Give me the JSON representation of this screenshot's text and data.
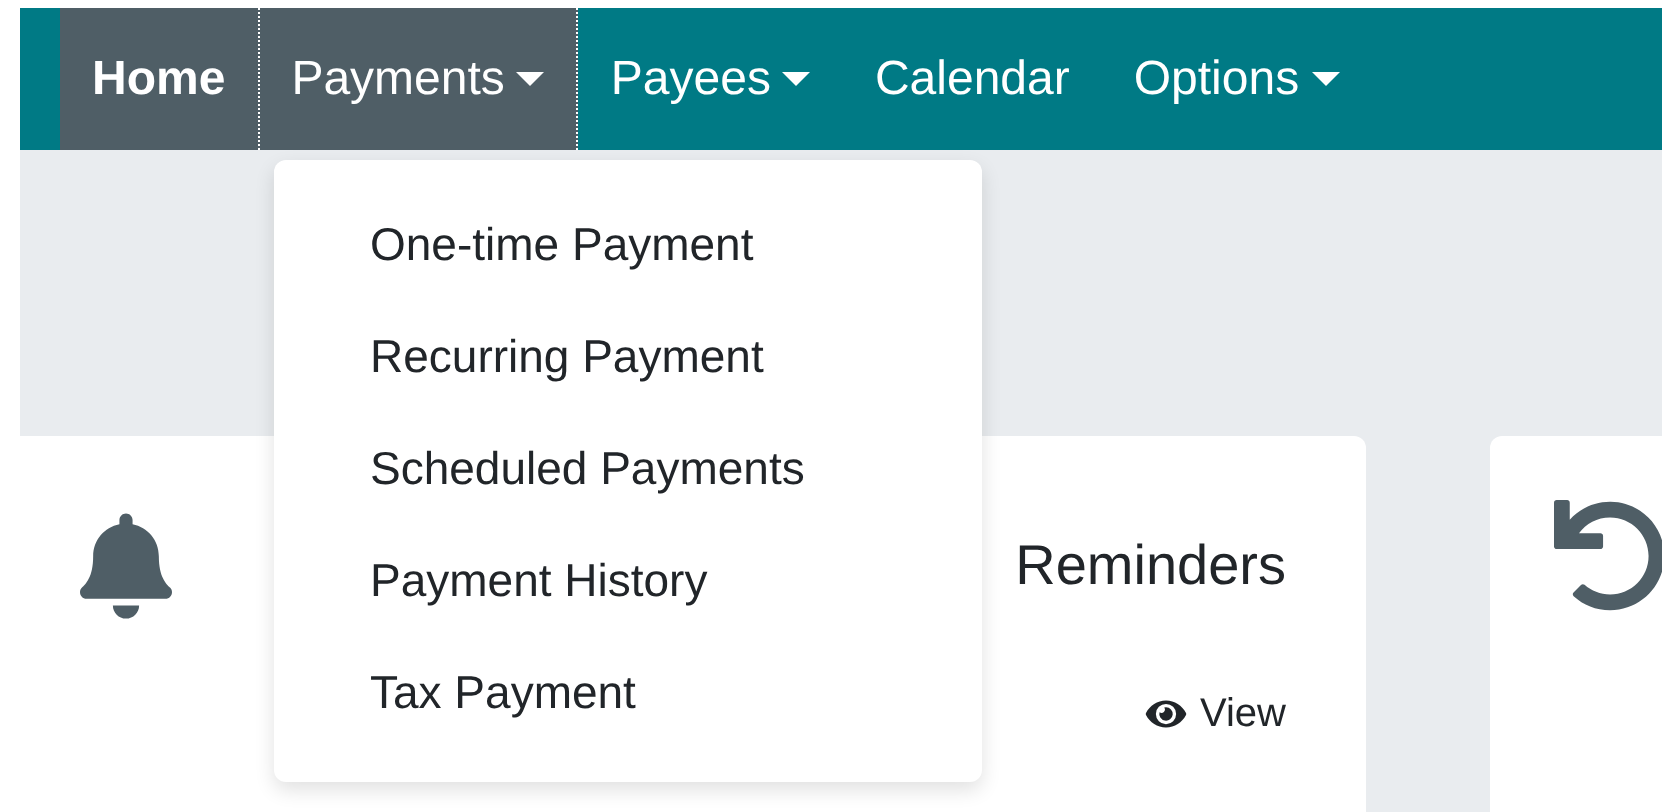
{
  "nav": {
    "items": [
      {
        "label": "Home",
        "selected": true,
        "caret": false,
        "expanded": false
      },
      {
        "label": "Payments",
        "selected": false,
        "caret": true,
        "expanded": true
      },
      {
        "label": "Payees",
        "selected": false,
        "caret": true,
        "expanded": false
      },
      {
        "label": "Calendar",
        "selected": false,
        "caret": false,
        "expanded": false
      },
      {
        "label": "Options",
        "selected": false,
        "caret": true,
        "expanded": false
      }
    ]
  },
  "dropdown": {
    "items": [
      "One-time Payment",
      "Recurring Payment",
      "Scheduled Payments",
      "Payment History",
      "Tax Payment"
    ]
  },
  "cards": [
    {
      "kind": "reminders",
      "title": "Reminders",
      "action": "View"
    },
    {
      "kind": "history"
    }
  ]
}
